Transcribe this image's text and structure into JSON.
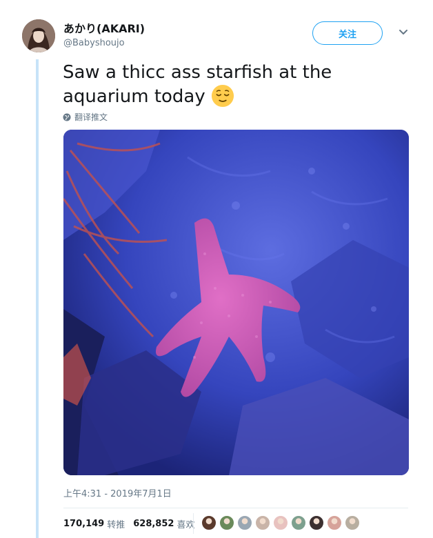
{
  "user": {
    "display_name": "あかり(AKARI)",
    "handle": "@Babyshoujo",
    "avatar_icon": "profile-avatar"
  },
  "follow_button": {
    "label": "关注"
  },
  "menu_icon": "chevron-down-icon",
  "tweet": {
    "text": "Saw a thicc ass starfish at the aquarium today",
    "emoji": "relieved-face-emoji"
  },
  "translate": {
    "label": "翻译推文",
    "icon": "globe-icon"
  },
  "photo": {
    "subject": "starfish-photo"
  },
  "timestamp": "上午4:31 - 2019年7月1日",
  "stats": {
    "retweets": {
      "value": "170,149",
      "label": "转推"
    },
    "likes": {
      "value": "628,852",
      "label": "喜欢"
    }
  },
  "liker_avatars": [
    "#5b3a2c",
    "#6a8a5a",
    "#9aa7b3",
    "#c9b4a8",
    "#e8c2bf",
    "#7da08e",
    "#3c3030",
    "#d6a39a",
    "#b8aea0"
  ],
  "colors": {
    "accent": "#1da1f2",
    "secondary_text": "#657786",
    "thread_line": "#c7e3f8"
  }
}
